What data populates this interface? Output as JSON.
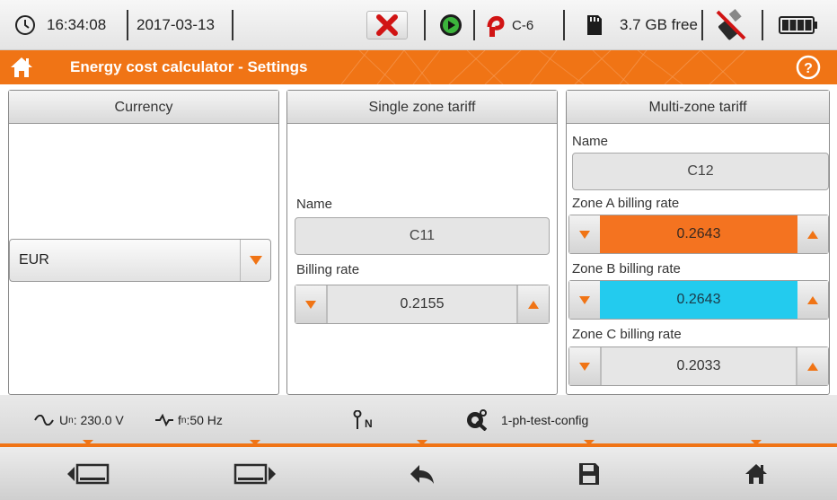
{
  "status_bar": {
    "time": "16:34:08",
    "date": "2017-03-13",
    "clamp": "C-6",
    "memory": "3.7 GB free",
    "icons": [
      "clock-icon",
      "error-x-icon",
      "recording-icon",
      "clamp-icon",
      "sd-card-icon",
      "usb-icon",
      "battery-icon"
    ]
  },
  "title_bar": {
    "title": "Energy cost calculator - Settings",
    "icons": [
      "home-icon",
      "help-icon"
    ]
  },
  "currency_panel": {
    "header": "Currency",
    "selected": "EUR"
  },
  "single_zone_panel": {
    "header": "Single zone tariff",
    "name_label": "Name",
    "name_value": "C11",
    "billing_label": "Billing rate",
    "billing_value": "0.2155"
  },
  "multi_zone_panel": {
    "header": "Multi-zone tariff",
    "name_label": "Name",
    "name_value": "C12",
    "zone_a_label": "Zone A billing rate",
    "zone_a_value": "0.2643",
    "zone_b_label": "Zone B billing rate",
    "zone_b_value": "0.2643",
    "zone_c_label": "Zone C billing rate",
    "zone_c_value": "0.2033"
  },
  "info_bar": {
    "voltage_prefix": "U",
    "voltage_sub": "n",
    "voltage_value": ": 230.0 V",
    "frequency_prefix": "f",
    "frequency_sub": "n",
    "frequency_value": ":50 Hz",
    "neutral_sub": "N",
    "config": "1-ph-test-config"
  },
  "nav_bar": {
    "icons": [
      "screen-left-icon",
      "screen-right-icon",
      "back-arrow-icon",
      "save-icon",
      "home-icon"
    ]
  },
  "colors": {
    "accent_orange": "#f07415",
    "zone_a_highlight": "#f47320",
    "zone_b_highlight": "#23cbee"
  }
}
